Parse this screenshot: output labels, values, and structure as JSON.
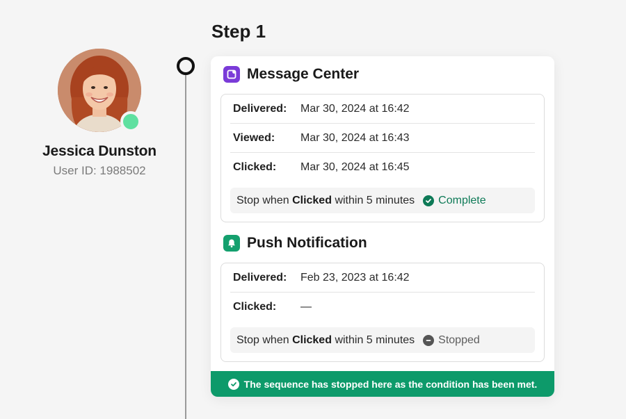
{
  "user": {
    "name": "Jessica Dunston",
    "user_id": "User ID: 1988502",
    "avatar_icon": "avatar-photo",
    "status_icon": "online-status-dot",
    "status_color": "#5fe0a0"
  },
  "step": {
    "title": "Step 1"
  },
  "channels": [
    {
      "title": "Message Center",
      "icon": "message-center-icon",
      "icon_color": "#7a3bd8",
      "rows": [
        {
          "label": "Delivered:",
          "value": "Mar 30, 2024 at 16:42"
        },
        {
          "label": "Viewed:",
          "value": "Mar 30, 2024 at 16:43"
        },
        {
          "label": "Clicked:",
          "value": "Mar 30, 2024 at 16:45"
        }
      ],
      "condition": {
        "prefix": "Stop when",
        "event": "Clicked",
        "suffix": "within 5 minutes",
        "status": "Complete",
        "status_icon": "check-circle-icon",
        "status_color": "#0e7a57"
      }
    },
    {
      "title": "Push Notification",
      "icon": "bell-icon",
      "icon_color": "#14a06e",
      "rows": [
        {
          "label": "Delivered:",
          "value": "Feb 23, 2023 at 16:42"
        },
        {
          "label": "Clicked:",
          "value": "—"
        }
      ],
      "condition": {
        "prefix": "Stop when",
        "event": "Clicked",
        "suffix": "within 5 minutes",
        "status": "Stopped",
        "status_icon": "minus-circle-icon",
        "status_color": "#555555"
      }
    }
  ],
  "banner": {
    "text": "The sequence has stopped here as the condition has been met.",
    "icon": "check-circle-icon",
    "color": "#0d9a6a"
  }
}
